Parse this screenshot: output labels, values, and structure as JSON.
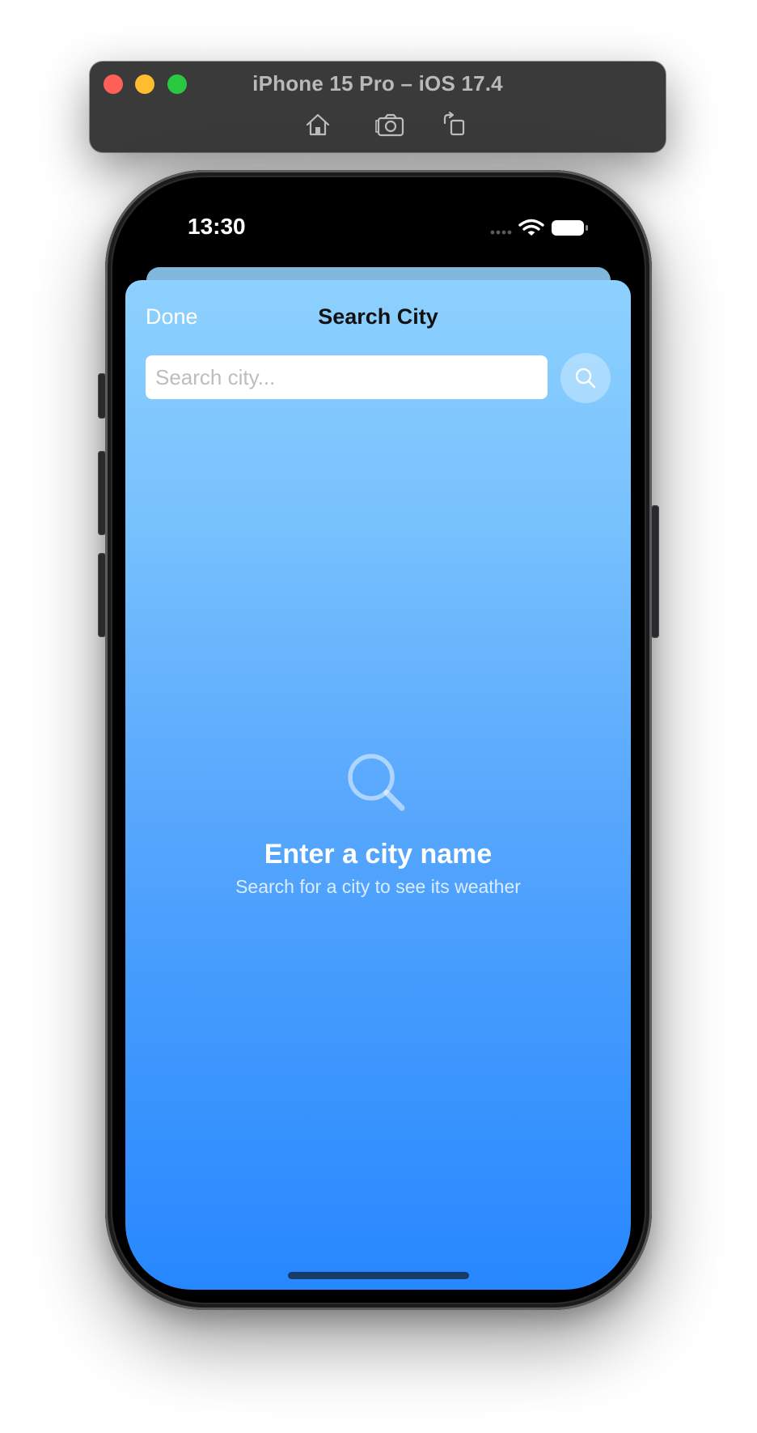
{
  "simulator": {
    "title": "iPhone 15 Pro – iOS 17.4",
    "tools": [
      {
        "icon": "home-icon"
      },
      {
        "icon": "screenshot-icon"
      },
      {
        "icon": "rotate-icon"
      }
    ],
    "traffic_lights": {
      "close": "#fe5f57",
      "minimize": "#febc2e",
      "zoom": "#28c840"
    }
  },
  "status_bar": {
    "time": "13:30",
    "icons": [
      "signal-icon",
      "wifi-icon",
      "battery-icon"
    ]
  },
  "search_sheet": {
    "done_label": "Done",
    "title": "Search City",
    "search": {
      "placeholder": "Search city...",
      "value": ""
    },
    "search_button_icon": "search-icon",
    "empty_state": {
      "icon": "magnifier-icon",
      "title": "Enter a city name",
      "subtitle": "Search for a city to see its weather"
    }
  },
  "colors": {
    "gradient_top": "#8dd1fe",
    "gradient_bottom": "#2787fe",
    "title_text": "#111111",
    "light_text": "#ffffff"
  }
}
